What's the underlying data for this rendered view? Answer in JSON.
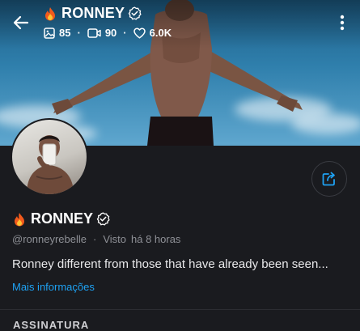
{
  "header": {
    "title": "RONNEY",
    "stats": {
      "photos": "85",
      "videos": "90",
      "likes": "6.0K"
    }
  },
  "profile": {
    "name": "RONNEY",
    "username": "@ronneyrebelle",
    "seen_label": "Visto",
    "seen_time": "há 8 horas",
    "bio": "Ronney different from those that have already been seen...",
    "more_info": "Mais informações"
  },
  "next_section": "ASSINATURA",
  "colors": {
    "background": "#1a1b1f",
    "link": "#1ea1f2",
    "muted_text": "#8e9096"
  },
  "icons": {
    "back": "arrow-left-icon",
    "flame": "flame-emoji-icon",
    "verified": "verified-badge-icon",
    "photo": "image-icon",
    "video": "video-icon",
    "like": "heart-icon",
    "more": "vertical-dots-icon",
    "share": "share-icon"
  }
}
